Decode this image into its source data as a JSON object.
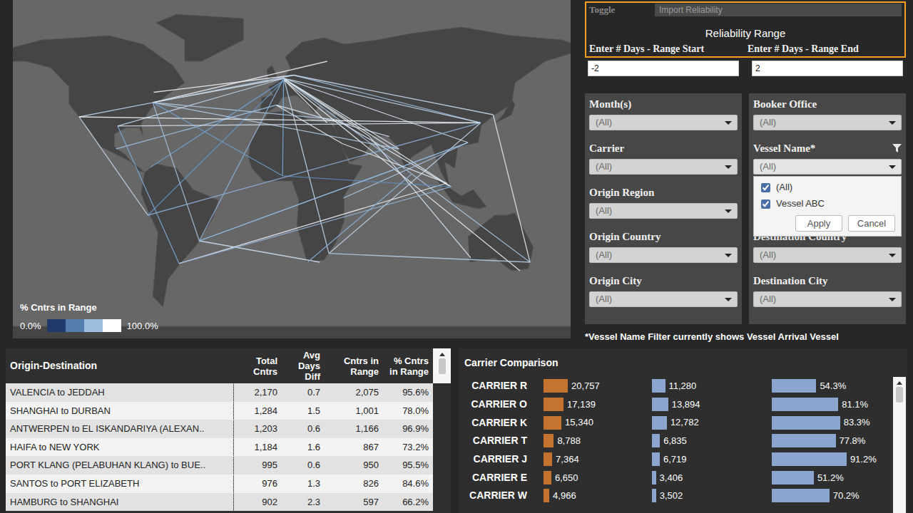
{
  "map": {
    "legend": {
      "title": "% Cntrs in Range",
      "min": "0.0%",
      "max": "100.0%"
    },
    "routes": [
      [
        -0.4,
        39.5,
        39,
        21.5,
        0.96
      ],
      [
        121.5,
        31.2,
        31,
        -29.9,
        0.78
      ],
      [
        4.4,
        51.2,
        29.9,
        31.2,
        0.97
      ],
      [
        35,
        32.8,
        -74,
        40.7,
        0.73
      ],
      [
        101.4,
        3,
        -58.4,
        -34.6,
        0.95
      ],
      [
        -46.3,
        -24,
        25.6,
        -34,
        0.85
      ],
      [
        10,
        53.5,
        121.5,
        31.2,
        0.66
      ],
      [
        4,
        52,
        -74,
        40.7,
        0.9
      ],
      [
        4,
        52,
        -95,
        29.7,
        0.8
      ],
      [
        4,
        52,
        114,
        22,
        0.85
      ],
      [
        4,
        52,
        103.8,
        1.3,
        0.92
      ],
      [
        4,
        52,
        151,
        -34,
        0.7
      ],
      [
        4,
        52,
        -46.3,
        -24,
        0.6
      ],
      [
        4,
        52,
        3.4,
        6.4,
        0.55
      ],
      [
        4,
        52,
        72.8,
        19,
        0.88
      ],
      [
        4,
        52,
        55,
        25,
        0.9
      ],
      [
        10,
        53.5,
        -73.5,
        45.5,
        0.95
      ],
      [
        10,
        53.5,
        129,
        35,
        0.82
      ],
      [
        10,
        53.5,
        -118,
        34,
        0.75
      ],
      [
        4.4,
        51.2,
        -75.5,
        10.4,
        0.5
      ],
      [
        4.4,
        51.2,
        -77,
        -12,
        0.45
      ],
      [
        4.4,
        51.2,
        31,
        -29.9,
        0.8
      ],
      [
        4.4,
        51.2,
        145,
        -38,
        0.93
      ],
      [
        -0.4,
        39.5,
        -96,
        19,
        0.65
      ],
      [
        -0.4,
        39.5,
        67,
        24.8,
        0.85
      ],
      [
        35,
        32.8,
        103.8,
        1.3,
        0.9
      ],
      [
        121.5,
        31.2,
        -118,
        34,
        0.98
      ],
      [
        121.5,
        31.2,
        4,
        52,
        0.8
      ],
      [
        114,
        22,
        -46.3,
        -24,
        0.55
      ],
      [
        114,
        22,
        39.6,
        -4,
        0.7
      ],
      [
        103.8,
        1.3,
        -58.4,
        -34.6,
        0.62
      ],
      [
        103.8,
        1.3,
        3.4,
        6.4,
        0.4
      ],
      [
        129,
        35,
        151,
        -34,
        0.9
      ],
      [
        72.8,
        19,
        -74,
        40.7,
        0.75
      ],
      [
        55,
        25,
        115.7,
        -32,
        0.85
      ],
      [
        80,
        7,
        18.4,
        -33.9,
        0.6
      ],
      [
        -74,
        40.7,
        -46.3,
        -24,
        0.7
      ],
      [
        -95,
        29.7,
        -58.4,
        -34.6,
        0.55
      ],
      [
        -74,
        40.7,
        3.4,
        6.4,
        0.5
      ],
      [
        -95,
        29.7,
        121.5,
        31.2,
        0.88
      ],
      [
        -77,
        -12,
        121.5,
        31.2,
        0.6
      ],
      [
        -118,
        34,
        -77,
        -12,
        0.8
      ],
      [
        30,
        60,
        -74,
        40.7,
        0.92
      ],
      [
        31,
        -29.9,
        151,
        -34,
        0.75
      ],
      [
        -46.3,
        -24,
        114,
        22,
        0.65
      ],
      [
        39,
        21.5,
        101.4,
        3,
        0.9
      ]
    ]
  },
  "controls": {
    "toggle": {
      "label": "Toggle",
      "value": "Import Reliability"
    },
    "range": {
      "title": "Reliability Range",
      "start": {
        "label": "Enter # Days - Range Start",
        "value": "-2"
      },
      "end": {
        "label": "Enter # Days - Range End",
        "value": "2"
      }
    }
  },
  "filters": {
    "left": [
      {
        "label": "Month(s)",
        "value": "(All)",
        "expanded": false
      },
      {
        "label": "Carrier",
        "value": "(All)",
        "expanded": false
      },
      {
        "label": "Origin Region",
        "value": "(All)",
        "expanded": false
      },
      {
        "label": "Origin Country",
        "value": "(All)",
        "expanded": false
      },
      {
        "label": "Origin City",
        "value": "(All)",
        "expanded": false
      }
    ],
    "right": [
      {
        "label": "Booker Office",
        "value": "(All)",
        "expanded": false
      },
      {
        "label": "Vessel Name*",
        "value": "(All)",
        "expanded": true
      },
      {
        "label": "Destination Country",
        "value": "(All)",
        "expanded": false
      },
      {
        "label": "Destination City",
        "value": "(All)",
        "expanded": false
      }
    ]
  },
  "vessel_menu": {
    "items": [
      {
        "label": "(All)",
        "checked": true
      },
      {
        "label": "Vessel ABC",
        "checked": true
      }
    ],
    "buttons": [
      "Apply",
      "Cancel"
    ]
  },
  "note": "*Vessel Name Filter currently shows Vessel Arrival Vessel",
  "od_table": {
    "columns": [
      "Origin-Destination",
      "Total Cntrs",
      "Avg Days Diff",
      "Cntrs in Range",
      "% Cntrs in Range"
    ],
    "rows": [
      [
        "VALENCIA to JEDDAH",
        "2,170",
        "0.7",
        "2,075",
        "95.6%"
      ],
      [
        "SHANGHAI to DURBAN",
        "1,284",
        "1.5",
        "1,001",
        "78.0%"
      ],
      [
        "ANTWERPEN to EL ISKANDARIYA (ALEXAN..",
        "1,203",
        "0.6",
        "1,166",
        "96.9%"
      ],
      [
        "HAIFA to NEW YORK",
        "1,184",
        "1.6",
        "867",
        "73.2%"
      ],
      [
        "PORT KLANG (PELABUHAN KLANG) to BUE..",
        "995",
        "0.6",
        "950",
        "95.5%"
      ],
      [
        "SANTOS to PORT ELIZABETH",
        "976",
        "1.3",
        "826",
        "84.6%"
      ],
      [
        "HAMBURG to SHANGHAI",
        "902",
        "2.3",
        "597",
        "66.2%"
      ]
    ]
  },
  "carrier_comparison": {
    "title": "Carrier Comparison",
    "rows": [
      {
        "name": "CARRIER R",
        "total": "20,757",
        "total_value": 20757,
        "in_range": "11,280",
        "in_range_value": 11280,
        "pct": "54.3%",
        "pct_value": 54.3
      },
      {
        "name": "CARRIER O",
        "total": "17,139",
        "total_value": 17139,
        "in_range": "13,894",
        "in_range_value": 13894,
        "pct": "81.1%",
        "pct_value": 81.1
      },
      {
        "name": "CARRIER K",
        "total": "15,340",
        "total_value": 15340,
        "in_range": "12,782",
        "in_range_value": 12782,
        "pct": "83.3%",
        "pct_value": 83.3
      },
      {
        "name": "CARRIER T",
        "total": "8,788",
        "total_value": 8788,
        "in_range": "6,835",
        "in_range_value": 6835,
        "pct": "77.8%",
        "pct_value": 77.8
      },
      {
        "name": "CARRIER J",
        "total": "7,364",
        "total_value": 7364,
        "in_range": "6,719",
        "in_range_value": 6719,
        "pct": "91.2%",
        "pct_value": 91.2
      },
      {
        "name": "CARRIER E",
        "total": "6,650",
        "total_value": 6650,
        "in_range": "3,406",
        "in_range_value": 3406,
        "pct": "51.2%",
        "pct_value": 51.2
      },
      {
        "name": "CARRIER W",
        "total": "4,966",
        "total_value": 4966,
        "in_range": "3,502",
        "in_range_value": 3502,
        "pct": "70.2%",
        "pct_value": 70.2
      }
    ]
  }
}
